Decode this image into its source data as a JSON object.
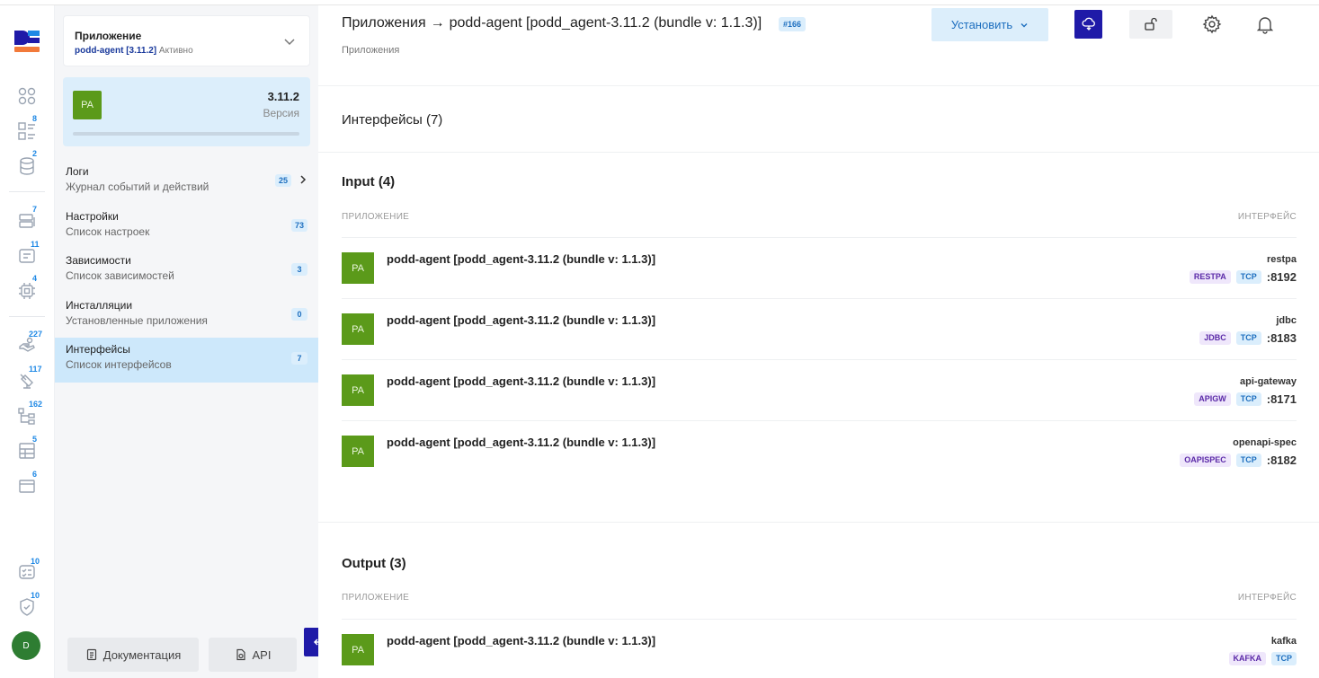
{
  "app": {
    "selector_title": "Приложение",
    "selector_app": "podd-agent [3.11.2]",
    "selector_status": "Активно",
    "avatar_initials": "PA",
    "version_number": "3.11.2",
    "version_label": "Версия"
  },
  "rail": {
    "logo": "DS",
    "badges": [
      "8",
      "2",
      "7",
      "11",
      "4",
      "227",
      "117",
      "162",
      "5",
      "6",
      "10",
      "10"
    ],
    "user_initial": "D"
  },
  "menu": [
    {
      "title": "Логи",
      "subtitle": "Журнал событий и действий",
      "count": "25",
      "has_chevron": true,
      "active": false
    },
    {
      "title": "Настройки",
      "subtitle": "Список настроек",
      "count": "73",
      "active": false
    },
    {
      "title": "Зависимости",
      "subtitle": "Список зависимостей",
      "count": "3",
      "active": false
    },
    {
      "title": "Инсталляции",
      "subtitle": "Установленные приложения",
      "count": "0",
      "active": false
    },
    {
      "title": "Интерфейсы",
      "subtitle": "Список интерфейсов",
      "count": "7",
      "active": true
    }
  ],
  "bottom": {
    "docs_label": "Документация",
    "api_label": "API"
  },
  "header": {
    "crumb_root": "Приложения",
    "crumb_arrow": "→",
    "crumb_current": "podd-agent [podd_agent-3.11.2 (bundle v: 1.1.3)]",
    "issue": "#166",
    "subtitle": "Приложения",
    "install_label": "Установить"
  },
  "interfaces": {
    "title": "Интерфейсы (7)",
    "col_app": "ПРИЛОЖЕНИЕ",
    "col_iface": "ИНТЕРФЕЙС",
    "input": {
      "title": "Input (4)",
      "rows": [
        {
          "app": "podd-agent [podd_agent-3.11.2 (bundle v: 1.1.3)]",
          "iface": "restpa",
          "proto": "RESTPA",
          "transport": "TCP",
          "port": ":8192"
        },
        {
          "app": "podd-agent [podd_agent-3.11.2 (bundle v: 1.1.3)]",
          "iface": "jdbc",
          "proto": "JDBC",
          "transport": "TCP",
          "port": ":8183"
        },
        {
          "app": "podd-agent [podd_agent-3.11.2 (bundle v: 1.1.3)]",
          "iface": "api-gateway",
          "proto": "APIGW",
          "transport": "TCP",
          "port": ":8171"
        },
        {
          "app": "podd-agent [podd_agent-3.11.2 (bundle v: 1.1.3)]",
          "iface": "openapi-spec",
          "proto": "OAPISPEC",
          "transport": "TCP",
          "port": ":8182"
        }
      ]
    },
    "output": {
      "title": "Output (3)",
      "rows": [
        {
          "app": "podd-agent [podd_agent-3.11.2 (bundle v: 1.1.3)]",
          "iface": "kafka",
          "proto": "KAFKA",
          "transport": "TCP",
          "port": ""
        }
      ]
    }
  }
}
